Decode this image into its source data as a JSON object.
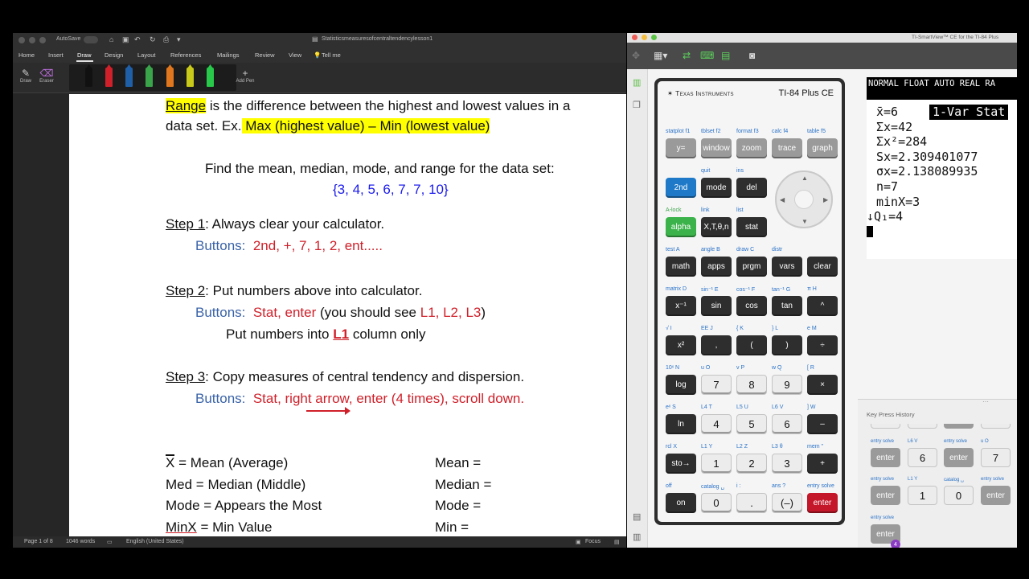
{
  "word": {
    "title_bar": {
      "autosave_label": "AutoSave",
      "toggle_label": "OFF",
      "doc_title": "Statisticsmeasuresofcentraltendencylesson1"
    },
    "menu": [
      "Home",
      "Insert",
      "Draw",
      "Design",
      "Layout",
      "References",
      "Mailings",
      "Review",
      "View",
      "Tell me"
    ],
    "ribbon": {
      "draw_label": "Draw",
      "eraser_label": "Eraser",
      "add_pen_label": "Add Pen"
    },
    "pen_colors": [
      "#111111",
      "#d0202a",
      "#1f5fa8",
      "#3aa44a",
      "#e0771e",
      "#c9c91a",
      "#28c84a"
    ],
    "document": {
      "range_word": "Range",
      "range_rest": " is the difference between the highest and lowest values in a",
      "line2_start": "data set.  Ex.",
      "line2_hl": " Max (highest value)  –  Min (lowest value)",
      "find_text": "Find the mean, median, mode, and range for the data set:",
      "data_set": "{3, 4, 5, 6, 7, 7, 10}",
      "step1_label": "Step 1",
      "step1_text": ":  Always clear your calculator.",
      "step1_buttons_label": "Buttons:",
      "step1_buttons": "2nd, +, 7, 1, 2, ent.....",
      "step2_label": "Step 2",
      "step2_text": ":  Put numbers above into calculator.",
      "step2_buttons_label": "Buttons:",
      "step2_buttons": "Stat, enter",
      "step2_see_pre": " (you should see ",
      "step2_see_lists": "L1, L2, L3",
      "step2_see_post": ")",
      "step2_put_pre": "Put numbers into ",
      "step2_put_l1": "L1",
      "step2_put_post": " column only",
      "step3_label": "Step 3",
      "step3_text": ":  Copy measures of central tendency and dispersion.",
      "step3_buttons_label": "Buttons:",
      "step3_buttons": "Stat, right arrow, enter (4 times), scroll down.",
      "defs": [
        {
          "sym": "X",
          "rest": " = Mean (Average)",
          "right": "Mean ="
        },
        {
          "sym": "Med",
          "rest": " = Median (Middle)",
          "right": "Median ="
        },
        {
          "sym": "Mode",
          "rest": " = Appears the Most",
          "right": "Mode ="
        },
        {
          "sym": "MinX",
          "rest": " = Min Value",
          "right": "Min ="
        }
      ]
    },
    "status": {
      "page": "Page 1 of 8",
      "words": "1046 words",
      "language": "English (United States)",
      "focus": "Focus"
    }
  },
  "ti": {
    "window_title": "TI-SmartView™ CE for the TI-84 Plus",
    "brand": "Texas Instruments",
    "model": "TI-84 Plus CE",
    "screen": {
      "header": "NORMAL FLOAT AUTO REAL RA",
      "title": "1-Var Stat",
      "lines": [
        "x̄=6",
        "Σx=42",
        "Σx²=284",
        "Sx=2.309401077",
        "σx=2.138089935",
        "n=7",
        "minX=3",
        "↓Q₁=4"
      ]
    },
    "keys": {
      "r1": [
        "y=",
        "window",
        "zoom",
        "trace",
        "graph"
      ],
      "r1_labels": [
        "statplot  f1",
        "tblset  f2",
        "format  f3",
        "calc  f4",
        "table  f5"
      ],
      "r2": [
        "2nd",
        "mode",
        "del"
      ],
      "r2_labels": [
        "quit",
        "ins"
      ],
      "r3": [
        "alpha",
        "X,T,θ,n",
        "stat"
      ],
      "r3_labels": [
        "A-lock",
        "link",
        "list"
      ],
      "r4": [
        "math",
        "apps",
        "prgm",
        "vars",
        "clear"
      ],
      "r4_labels": [
        "test  A",
        "angle  B",
        "draw  C",
        "distr",
        ""
      ],
      "r5": [
        "x⁻¹",
        "sin",
        "cos",
        "tan",
        "^"
      ],
      "r5_labels": [
        "matrix  D",
        "sin⁻¹  E",
        "cos⁻¹  F",
        "tan⁻¹  G",
        "π  H"
      ],
      "r6": [
        "x²",
        ",",
        "(",
        ")",
        "÷"
      ],
      "r6_labels": [
        "√  I",
        "EE  J",
        "{  K",
        "}  L",
        "e  M"
      ],
      "r7": [
        "log",
        "7",
        "8",
        "9",
        "×"
      ],
      "r7_labels": [
        "10ˣ  N",
        "u  O",
        "v  P",
        "w  Q",
        "[  R"
      ],
      "r8": [
        "ln",
        "4",
        "5",
        "6",
        "–"
      ],
      "r8_labels": [
        "eˣ  S",
        "L4  T",
        "L5  U",
        "L6  V",
        "]  W"
      ],
      "r9": [
        "sto→",
        "1",
        "2",
        "3",
        "+"
      ],
      "r9_labels": [
        "rcl  X",
        "L1  Y",
        "L2  Z",
        "L3  θ",
        "mem  \""
      ],
      "r10": [
        "on",
        "0",
        ".",
        "(–)",
        "enter"
      ],
      "r10_labels": [
        "off",
        "catalog  ␣",
        "i  :",
        "ans  ?",
        "entry solve"
      ]
    },
    "history": {
      "title": "Key Press History",
      "row1": [
        "enter",
        "6",
        "enter",
        "7"
      ],
      "row1_labels": [
        "entry solve",
        "L6  V",
        "entry solve",
        "u  O"
      ],
      "row2": [
        "enter",
        "1",
        "0",
        "enter"
      ],
      "row2_labels": [
        "entry solve",
        "L1  Y",
        "catalog  ␣",
        "entry solve"
      ],
      "row3": [
        "enter"
      ],
      "row3_labels": [
        "entry solve"
      ],
      "badge": "4"
    }
  }
}
